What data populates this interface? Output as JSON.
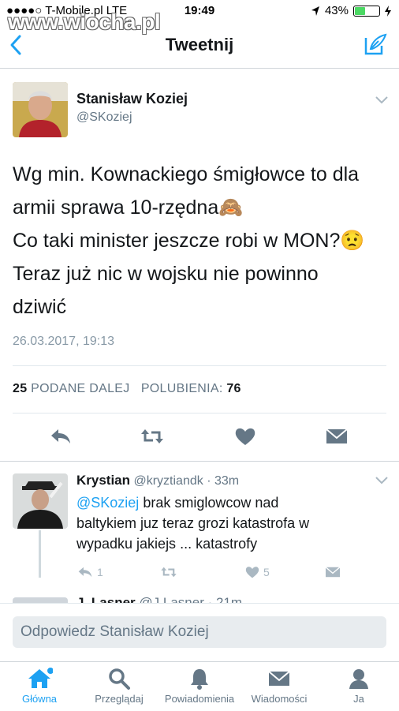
{
  "status_bar": {
    "carrier": "●●●●○ T-Mobile.pl  LTE",
    "time": "19:49",
    "battery": "43%",
    "battery_level": 0.43
  },
  "watermark": "www.wiocha.pl",
  "nav": {
    "title": "Tweetnij"
  },
  "tweet": {
    "author_name": "Stanisław Koziej",
    "author_handle": "@SKoziej",
    "text_lines": [
      "Wg min. Kownackiego śmigłowce to dla",
      "armii sprawa 10-rzędna🙈",
      "Co taki minister jeszcze robi w MON?😟",
      "Teraz już nic w wojsku nie powinno",
      "dziwić"
    ],
    "timestamp": "26.03.2017, 19:13",
    "retweets_count": "25",
    "retweets_label": "PODANE DALEJ",
    "likes_label": "POLUBIENIA:",
    "likes_count": "76"
  },
  "reply": {
    "name": "Krystian",
    "handle": "@kryztiandk",
    "time": "· 33m",
    "mention": "@SKoziej",
    "text_line1": " brak smiglowcow nad",
    "text_line2": "baltykiem juz teraz grozi katastrofa w",
    "text_line3": "wypadku jakiejs ... katastrofy",
    "reply_count": "1",
    "like_count": "5"
  },
  "next_reply": {
    "name_partial": "J. Lasner",
    "handle_partial": "@J.Lasner · 21m"
  },
  "reply_box": {
    "placeholder": "Odpowiedz Stanisław Koziej"
  },
  "tabs": [
    {
      "label": "Główna",
      "icon": "home-icon",
      "active": true
    },
    {
      "label": "Przeglądaj",
      "icon": "search-icon"
    },
    {
      "label": "Powiadomienia",
      "icon": "bell-icon"
    },
    {
      "label": "Wiadomości",
      "icon": "envelope-icon"
    },
    {
      "label": "Ja",
      "icon": "person-icon"
    }
  ],
  "colors": {
    "accent": "#1da1f2",
    "text": "#14171a",
    "secondary": "#657786"
  }
}
